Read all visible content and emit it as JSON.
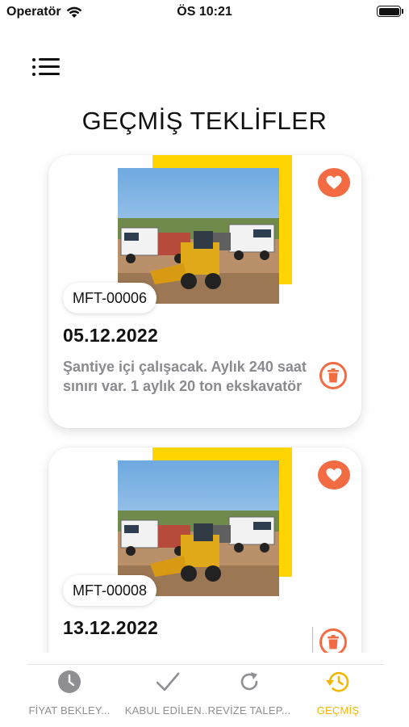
{
  "status_bar": {
    "carrier": "Operatör",
    "time": "ÖS 10:21"
  },
  "page": {
    "title": "GEÇMİŞ TEKLİFLER"
  },
  "offers": [
    {
      "code": "MFT-00006",
      "date": "05.12.2022",
      "description": "Şantiye içi çalışacak. Aylık 240 saat sınırı var. 1 aylık 20 ton ekskavatör"
    },
    {
      "code": "MFT-00008",
      "date": "13.12.2022",
      "description": ""
    }
  ],
  "tabs": [
    {
      "label": "FİYAT BEKLEY...",
      "icon": "clock-icon",
      "active": false
    },
    {
      "label": "KABUL EDİLEN...",
      "icon": "checkmark-icon",
      "active": false
    },
    {
      "label": "REVİZE TALEP...",
      "icon": "refresh-icon",
      "active": false
    },
    {
      "label": "GEÇMİŞ",
      "icon": "history-icon",
      "active": true
    }
  ],
  "colors": {
    "accent_orange": "#F26B43",
    "accent_yellow": "#FFD400",
    "active_tab": "#F2B705",
    "inactive_tab": "#8e8e93",
    "description_gray": "#8a8a8f"
  }
}
